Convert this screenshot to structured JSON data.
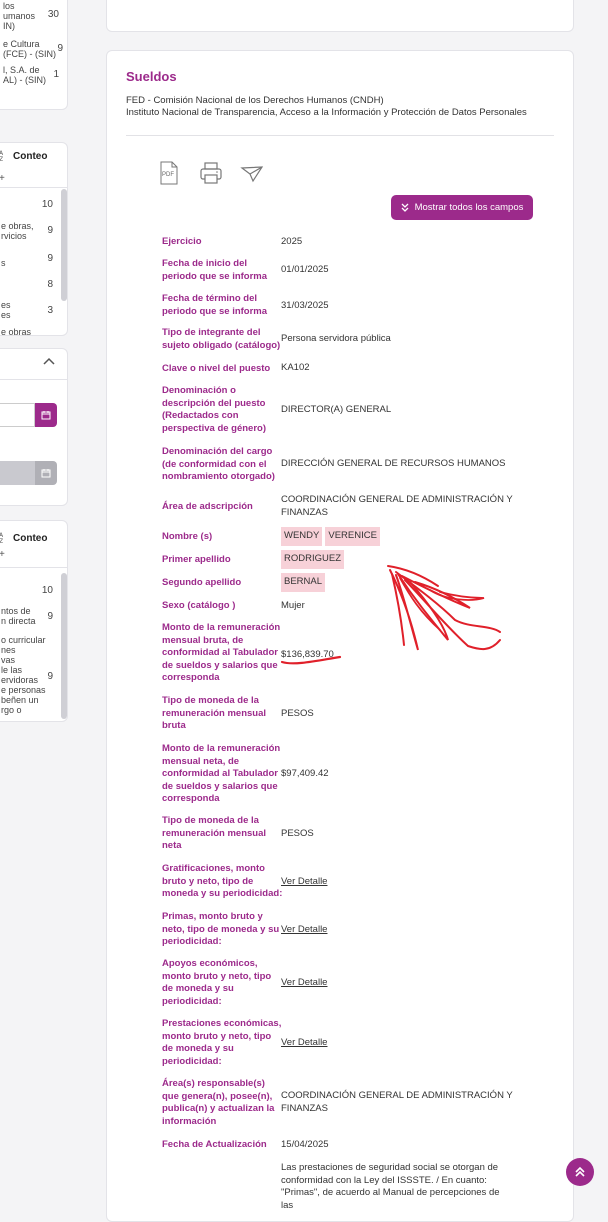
{
  "sidebar": {
    "card1_rows": [
      {
        "label": "los",
        "count": ""
      },
      {
        "label": "umanos",
        "count": "30"
      },
      {
        "label": "IN)",
        "count": ""
      },
      {
        "label": "e Cultura",
        "count": ""
      },
      {
        "label": "(FCE) - (SIN)",
        "count": "9"
      },
      {
        "label": "l, S.A. de",
        "count": ""
      },
      {
        "label": "AL) - (SIN)",
        "count": "1"
      }
    ],
    "card2_header": "Conteo",
    "card2_rows": [
      {
        "label": "",
        "count": "10"
      },
      {
        "label": "e obras,\nrvicios",
        "count": "9"
      },
      {
        "label": "s",
        "count": "9"
      },
      {
        "label": "",
        "count": "8"
      },
      {
        "label": "es\nes",
        "count": "3"
      },
      {
        "label": "e obras",
        "count": ""
      }
    ],
    "card4_header": "Conteo",
    "card4_rows": [
      {
        "label": "",
        "count": "10"
      },
      {
        "label": "ntos de\nn directa",
        "count": "9"
      },
      {
        "label": "o curricular\nnes\nvas\nle las\nervidoras\ne personas\nbeñen un\nrgo o",
        "count": "9"
      }
    ]
  },
  "main": {
    "title": "Sueldos",
    "org_line1": "FED - Comisión Nacional de los Derechos Humanos (CNDH)",
    "org_line2": "Instituto Nacional de Transparencia, Acceso a la Información y Protección de Datos Personales",
    "toolbar": {
      "pdf_label": "PDF",
      "show_all_label": "Mostrar todos los campos"
    },
    "fields": {
      "ejercicio": {
        "label": "Ejercicio",
        "value": "2025"
      },
      "fecha_inicio": {
        "label": "Fecha de inicio del periodo que se informa",
        "value": "01/01/2025"
      },
      "fecha_termino": {
        "label": "Fecha de término del periodo que se informa",
        "value": "31/03/2025"
      },
      "tipo_integrante": {
        "label": "Tipo de integrante del sujeto obligado (catálogo)",
        "value": "Persona servidora pública"
      },
      "clave_nivel": {
        "label": "Clave o nivel del puesto",
        "value": "KA102"
      },
      "denominacion_puesto": {
        "label": "Denominación o descripción del puesto (Redactados con perspectiva de género)",
        "value": "DIRECTOR(A) GENERAL"
      },
      "denominacion_cargo": {
        "label": "Denominación del cargo (de conformidad con el nombramiento otorgado)",
        "value": "DIRECCIÓN GENERAL DE RECURSOS HUMANOS"
      },
      "area_adscripcion": {
        "label": "Área de adscripción",
        "value": "COORDINACIÓN GENERAL DE ADMINISTRACIÓN Y FINANZAS"
      },
      "nombre": {
        "label": "Nombre (s)",
        "value_1": "WENDY",
        "value_2": "VERENICE"
      },
      "primer_apellido": {
        "label": "Primer apellido",
        "value": "RODRIGUEZ"
      },
      "segundo_apellido": {
        "label": "Segundo apellido",
        "value": "BERNAL"
      },
      "sexo": {
        "label": "Sexo (catálogo )",
        "value": "Mujer"
      },
      "monto_bruta": {
        "label": "Monto de la remuneración mensual bruta, de conformidad al Tabulador de sueldos y salarios que corresponda",
        "value": "$136,839.70"
      },
      "moneda_bruta": {
        "label": "Tipo de moneda de la remuneración mensual bruta",
        "value": "PESOS"
      },
      "monto_neta": {
        "label": "Monto de la remuneración mensual neta, de conformidad al Tabulador de sueldos y salarios que corresponda",
        "value": "$97,409.42"
      },
      "moneda_neta": {
        "label": "Tipo de moneda de la remuneración mensual neta",
        "value": "PESOS"
      },
      "gratificaciones": {
        "label": "Gratificaciones, monto bruto y neto, tipo de moneda y su periodicidad:",
        "value": "Ver Detalle"
      },
      "primas": {
        "label": "Primas, monto bruto y neto, tipo de moneda y su periodicidad:",
        "value": "Ver Detalle"
      },
      "apoyos": {
        "label": "Apoyos económicos, monto bruto y neto, tipo de moneda y su periodicidad:",
        "value": "Ver Detalle"
      },
      "prestaciones": {
        "label": "Prestaciones económicas, monto bruto y neto, tipo de moneda y su periodicidad:",
        "value": "Ver Detalle"
      },
      "area_responsable": {
        "label": "Área(s) responsable(s) que genera(n), posee(n), publica(n) y actualizan la información",
        "value": "COORDINACIÓN GENERAL DE ADMINISTRACIÓN Y FINANZAS"
      },
      "fecha_actualizacion": {
        "label": "Fecha de Actualización",
        "value": "15/04/2025"
      },
      "nota": {
        "value": "Las prestaciones de seguridad social se otorgan de conformidad con la Ley del ISSSTE. / En cuanto: \"Primas\", de acuerdo al Manual de percepciones de las"
      }
    }
  },
  "colors": {
    "accent": "#9c2a8b",
    "highlight": "#f7d1d8",
    "annotation": "#e0202a"
  }
}
